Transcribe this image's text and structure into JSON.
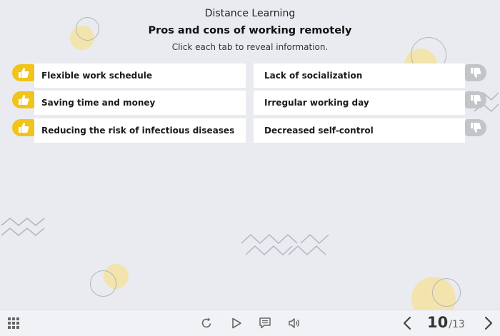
{
  "header": {
    "course_title": "Distance Learning",
    "slide_title": "Pros and cons of working remotely",
    "instruction": "Click each tab to reveal information."
  },
  "pros": [
    {
      "label": "Flexible work schedule",
      "icon": "thumbs-up-icon"
    },
    {
      "label": "Saving time and money",
      "icon": "thumbs-up-icon"
    },
    {
      "label": "Reducing the risk of infectious diseases",
      "icon": "thumbs-up-icon"
    }
  ],
  "cons": [
    {
      "label": "Lack of socialization",
      "icon": "thumbs-down-icon"
    },
    {
      "label": "Irregular working day",
      "icon": "thumbs-down-icon"
    },
    {
      "label": "Decreased self-control",
      "icon": "thumbs-down-icon"
    }
  ],
  "toolbar": {
    "menu_icon": "grid-menu-icon",
    "replay_icon": "replay-icon",
    "play_icon": "play-icon",
    "notes_icon": "notes-icon",
    "volume_icon": "volume-icon",
    "prev_icon": "chevron-left-icon",
    "next_icon": "chevron-right-icon",
    "current_page": "10",
    "total_pages": "/13"
  },
  "colors": {
    "background": "#e9ebf0",
    "pro_accent": "#f0c419",
    "con_accent": "#c3c4c7",
    "tab_background": "#ffffff"
  }
}
